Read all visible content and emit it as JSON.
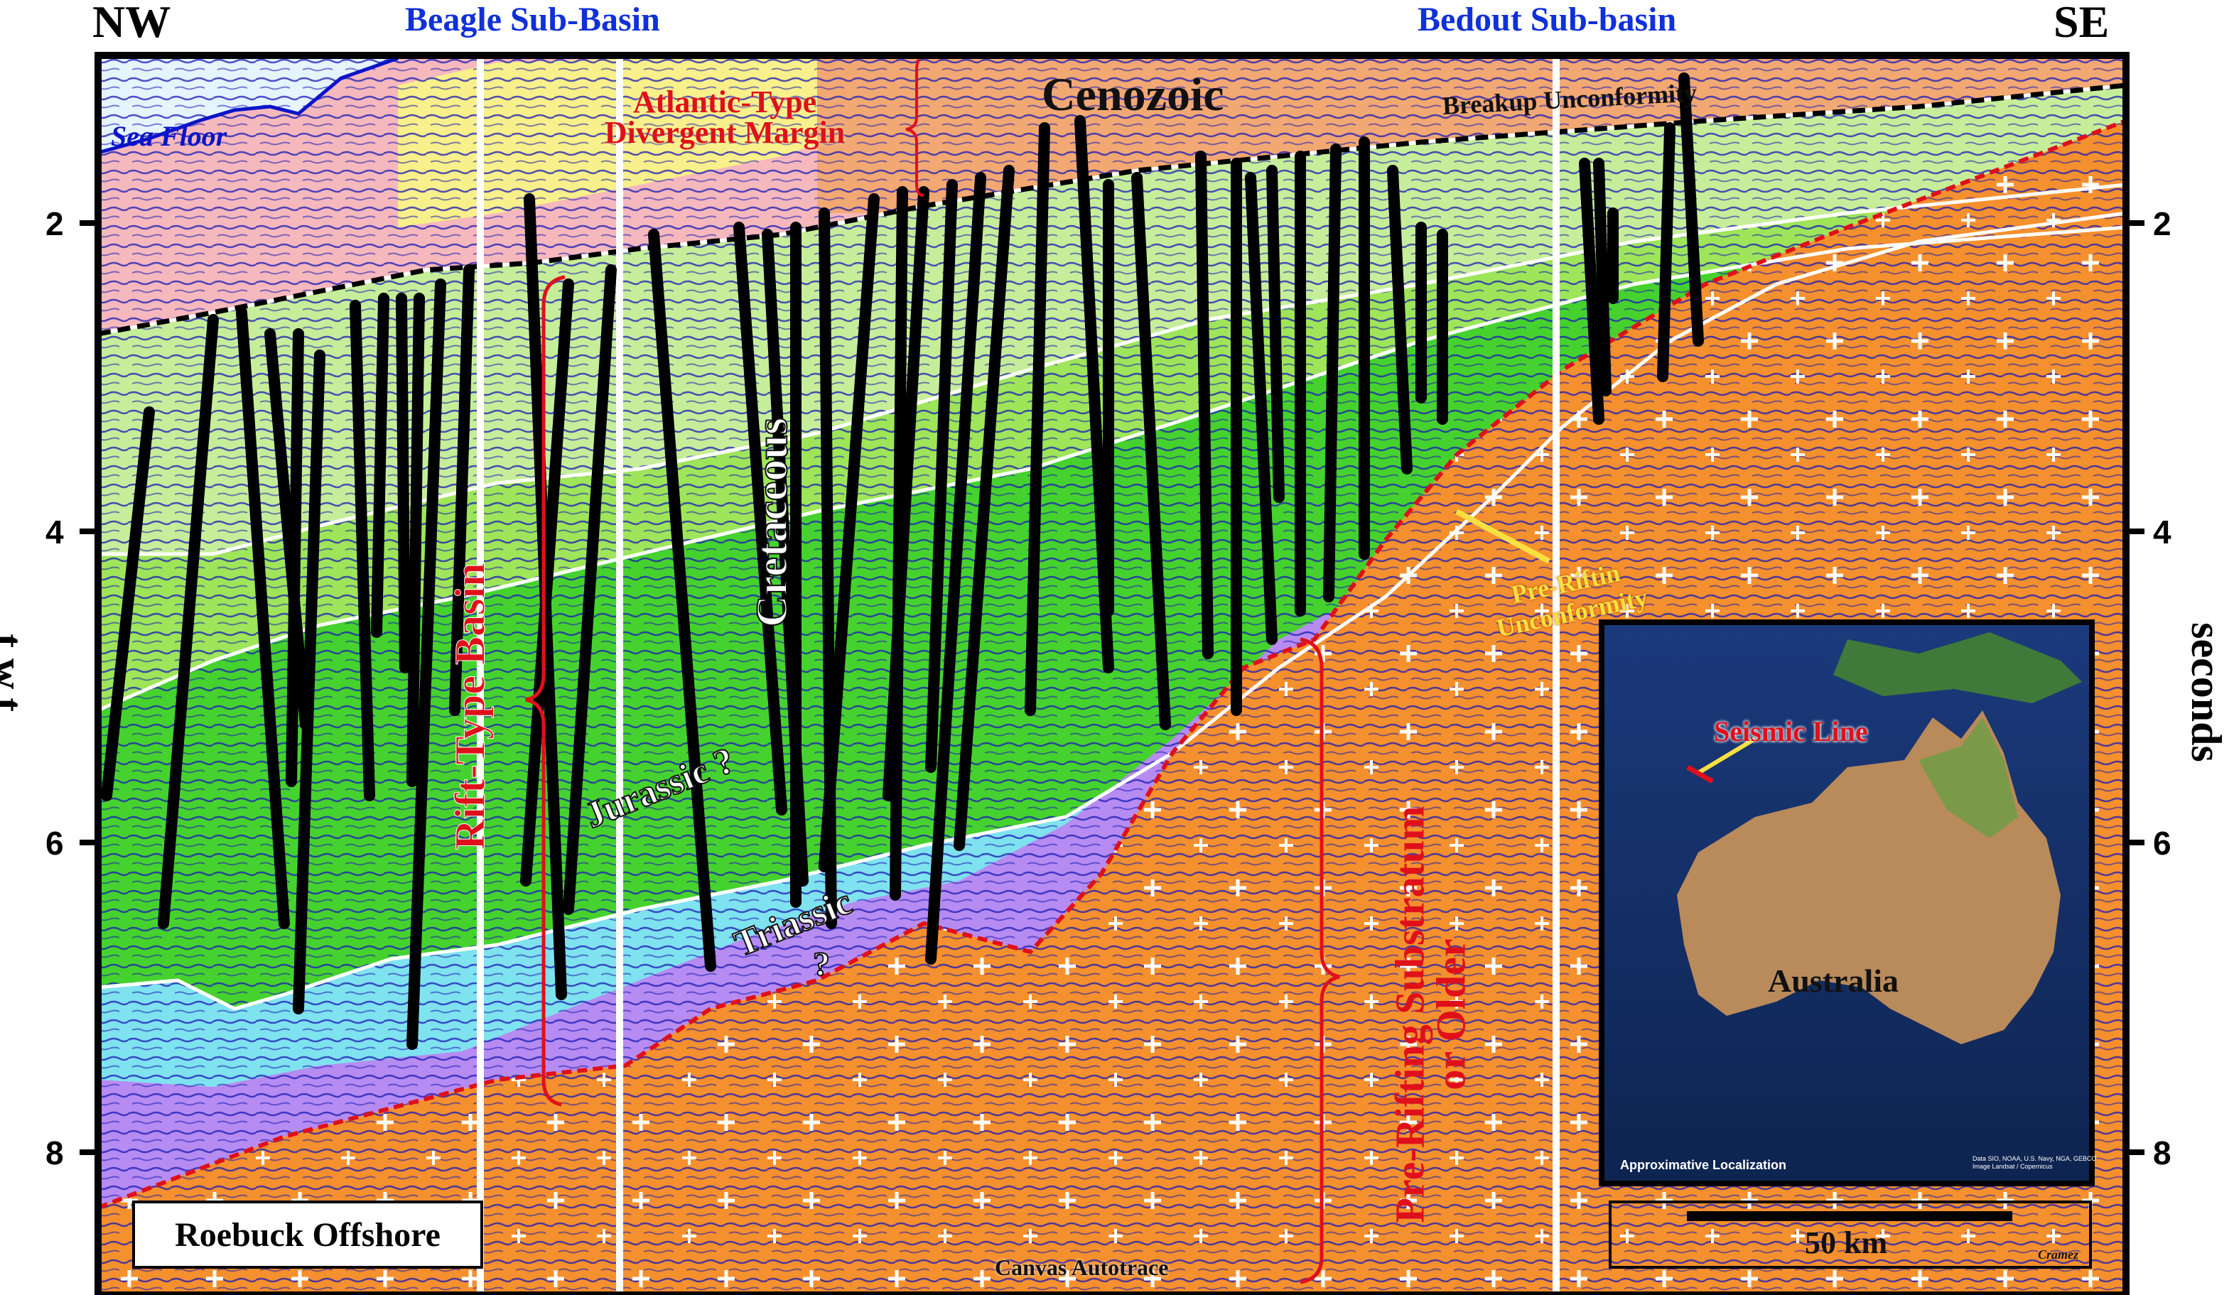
{
  "header": {
    "left_direction": "NW",
    "right_direction": "SE",
    "left_basin": "Beagle Sub-Basin",
    "right_basin": "Bedout Sub-basin"
  },
  "axes": {
    "left_label": "t.w.t.",
    "right_label": "seconds",
    "ticks": [
      "2",
      "4",
      "6",
      "8"
    ]
  },
  "labels": {
    "sea_floor": "Sea Floor",
    "atlantic_line1": "Atlantic-Type",
    "atlantic_line2": "Divergent Margin",
    "cenozoic": "Cenozoic",
    "breakup": "Breakup Unconformity",
    "cretaceous": "Cretaceous",
    "rift_basin": "Rift-Type Basin",
    "jurassic": "Jurassic ?",
    "triassic": "Triassic",
    "question": "?",
    "pre_rift_unconf_line1": "Pre-Riftin",
    "pre_rift_unconf_line2": "Unconformity",
    "substratum_line1": "Pre-Rifting Substratum",
    "substratum_line2": "or Older",
    "canvas": "Canvas Autotrace",
    "location_box": "Roebuck Offshore"
  },
  "inset_map": {
    "seismic_line": "Seismic Line",
    "country": "Australia",
    "localization": "Approximative Localization",
    "credits_line1": "Data SIO, NOAA, U.S. Navy, NGA, GEBCO",
    "credits_line2": "Image Landsat / Copernicus"
  },
  "scale": {
    "label": "50 km",
    "author": "Cramez"
  },
  "colors": {
    "water": "#e6f4ff",
    "cenozoic_pink": "#f5b8bd",
    "cenozoic_yellow": "#f8f08a",
    "cenozoic_orange": "#f2a873",
    "cretaceous_light": "#c6ee9a",
    "cretaceous_mid": "#9ee55a",
    "cretaceous_dark": "#46d22e",
    "jurassic": "#7fe2ef",
    "triassic": "#b68cf2",
    "substratum": "#f5902e",
    "fault": "#000000",
    "seismic": "#1a1ab4",
    "label_red": "#e0101a",
    "title_blue": "#1030d8"
  }
}
